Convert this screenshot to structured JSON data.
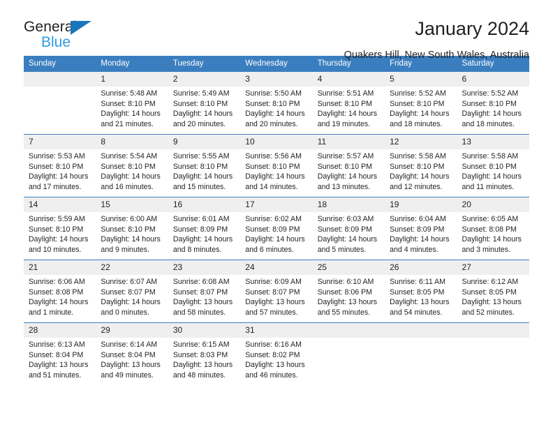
{
  "brand": {
    "name_part1": "General",
    "name_part2": "Blue",
    "triangle_color": "#1a76bc",
    "blue_color": "#2e9bdf"
  },
  "header": {
    "title": "January 2024",
    "subtitle": "Quakers Hill, New South Wales, Australia"
  },
  "colors": {
    "header_blue": "#3a7ebf",
    "daynum_bg": "#efefef",
    "text": "#231f20"
  },
  "weekday_headers": [
    "Sunday",
    "Monday",
    "Tuesday",
    "Wednesday",
    "Thursday",
    "Friday",
    "Saturday"
  ],
  "labels": {
    "sunrise": "Sunrise:",
    "sunset": "Sunset:",
    "daylight": "Daylight:"
  },
  "weeks": [
    [
      {
        "day": ""
      },
      {
        "day": "1",
        "sunrise": "Sunrise: 5:48 AM",
        "sunset": "Sunset: 8:10 PM",
        "daylight": "Daylight: 14 hours and 21 minutes."
      },
      {
        "day": "2",
        "sunrise": "Sunrise: 5:49 AM",
        "sunset": "Sunset: 8:10 PM",
        "daylight": "Daylight: 14 hours and 20 minutes."
      },
      {
        "day": "3",
        "sunrise": "Sunrise: 5:50 AM",
        "sunset": "Sunset: 8:10 PM",
        "daylight": "Daylight: 14 hours and 20 minutes."
      },
      {
        "day": "4",
        "sunrise": "Sunrise: 5:51 AM",
        "sunset": "Sunset: 8:10 PM",
        "daylight": "Daylight: 14 hours and 19 minutes."
      },
      {
        "day": "5",
        "sunrise": "Sunrise: 5:52 AM",
        "sunset": "Sunset: 8:10 PM",
        "daylight": "Daylight: 14 hours and 18 minutes."
      },
      {
        "day": "6",
        "sunrise": "Sunrise: 5:52 AM",
        "sunset": "Sunset: 8:10 PM",
        "daylight": "Daylight: 14 hours and 18 minutes."
      }
    ],
    [
      {
        "day": "7",
        "sunrise": "Sunrise: 5:53 AM",
        "sunset": "Sunset: 8:10 PM",
        "daylight": "Daylight: 14 hours and 17 minutes."
      },
      {
        "day": "8",
        "sunrise": "Sunrise: 5:54 AM",
        "sunset": "Sunset: 8:10 PM",
        "daylight": "Daylight: 14 hours and 16 minutes."
      },
      {
        "day": "9",
        "sunrise": "Sunrise: 5:55 AM",
        "sunset": "Sunset: 8:10 PM",
        "daylight": "Daylight: 14 hours and 15 minutes."
      },
      {
        "day": "10",
        "sunrise": "Sunrise: 5:56 AM",
        "sunset": "Sunset: 8:10 PM",
        "daylight": "Daylight: 14 hours and 14 minutes."
      },
      {
        "day": "11",
        "sunrise": "Sunrise: 5:57 AM",
        "sunset": "Sunset: 8:10 PM",
        "daylight": "Daylight: 14 hours and 13 minutes."
      },
      {
        "day": "12",
        "sunrise": "Sunrise: 5:58 AM",
        "sunset": "Sunset: 8:10 PM",
        "daylight": "Daylight: 14 hours and 12 minutes."
      },
      {
        "day": "13",
        "sunrise": "Sunrise: 5:58 AM",
        "sunset": "Sunset: 8:10 PM",
        "daylight": "Daylight: 14 hours and 11 minutes."
      }
    ],
    [
      {
        "day": "14",
        "sunrise": "Sunrise: 5:59 AM",
        "sunset": "Sunset: 8:10 PM",
        "daylight": "Daylight: 14 hours and 10 minutes."
      },
      {
        "day": "15",
        "sunrise": "Sunrise: 6:00 AM",
        "sunset": "Sunset: 8:10 PM",
        "daylight": "Daylight: 14 hours and 9 minutes."
      },
      {
        "day": "16",
        "sunrise": "Sunrise: 6:01 AM",
        "sunset": "Sunset: 8:09 PM",
        "daylight": "Daylight: 14 hours and 8 minutes."
      },
      {
        "day": "17",
        "sunrise": "Sunrise: 6:02 AM",
        "sunset": "Sunset: 8:09 PM",
        "daylight": "Daylight: 14 hours and 6 minutes."
      },
      {
        "day": "18",
        "sunrise": "Sunrise: 6:03 AM",
        "sunset": "Sunset: 8:09 PM",
        "daylight": "Daylight: 14 hours and 5 minutes."
      },
      {
        "day": "19",
        "sunrise": "Sunrise: 6:04 AM",
        "sunset": "Sunset: 8:09 PM",
        "daylight": "Daylight: 14 hours and 4 minutes."
      },
      {
        "day": "20",
        "sunrise": "Sunrise: 6:05 AM",
        "sunset": "Sunset: 8:08 PM",
        "daylight": "Daylight: 14 hours and 3 minutes."
      }
    ],
    [
      {
        "day": "21",
        "sunrise": "Sunrise: 6:06 AM",
        "sunset": "Sunset: 8:08 PM",
        "daylight": "Daylight: 14 hours and 1 minute."
      },
      {
        "day": "22",
        "sunrise": "Sunrise: 6:07 AM",
        "sunset": "Sunset: 8:07 PM",
        "daylight": "Daylight: 14 hours and 0 minutes."
      },
      {
        "day": "23",
        "sunrise": "Sunrise: 6:08 AM",
        "sunset": "Sunset: 8:07 PM",
        "daylight": "Daylight: 13 hours and 58 minutes."
      },
      {
        "day": "24",
        "sunrise": "Sunrise: 6:09 AM",
        "sunset": "Sunset: 8:07 PM",
        "daylight": "Daylight: 13 hours and 57 minutes."
      },
      {
        "day": "25",
        "sunrise": "Sunrise: 6:10 AM",
        "sunset": "Sunset: 8:06 PM",
        "daylight": "Daylight: 13 hours and 55 minutes."
      },
      {
        "day": "26",
        "sunrise": "Sunrise: 6:11 AM",
        "sunset": "Sunset: 8:05 PM",
        "daylight": "Daylight: 13 hours and 54 minutes."
      },
      {
        "day": "27",
        "sunrise": "Sunrise: 6:12 AM",
        "sunset": "Sunset: 8:05 PM",
        "daylight": "Daylight: 13 hours and 52 minutes."
      }
    ],
    [
      {
        "day": "28",
        "sunrise": "Sunrise: 6:13 AM",
        "sunset": "Sunset: 8:04 PM",
        "daylight": "Daylight: 13 hours and 51 minutes."
      },
      {
        "day": "29",
        "sunrise": "Sunrise: 6:14 AM",
        "sunset": "Sunset: 8:04 PM",
        "daylight": "Daylight: 13 hours and 49 minutes."
      },
      {
        "day": "30",
        "sunrise": "Sunrise: 6:15 AM",
        "sunset": "Sunset: 8:03 PM",
        "daylight": "Daylight: 13 hours and 48 minutes."
      },
      {
        "day": "31",
        "sunrise": "Sunrise: 6:16 AM",
        "sunset": "Sunset: 8:02 PM",
        "daylight": "Daylight: 13 hours and 46 minutes."
      },
      {
        "day": ""
      },
      {
        "day": ""
      },
      {
        "day": ""
      }
    ]
  ]
}
